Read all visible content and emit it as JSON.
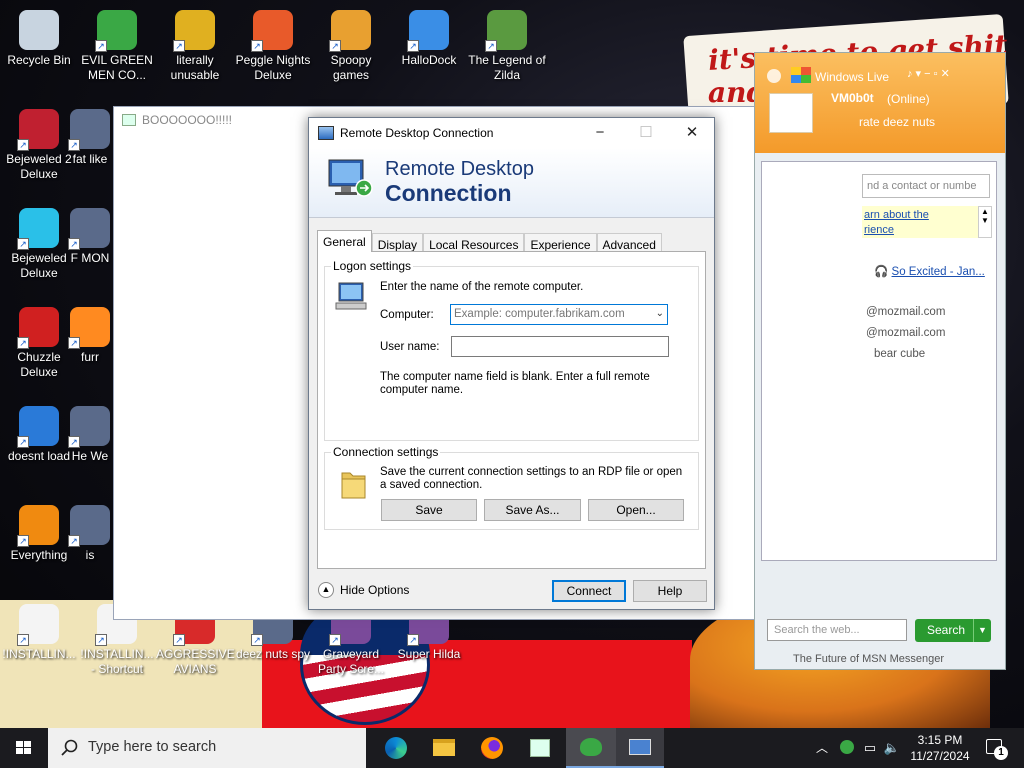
{
  "wallpaper": {
    "note_line1": "it's time to get shit",
    "note_line2": "and"
  },
  "desktop_icons": [
    {
      "label": "Recycle Bin",
      "icon": "recycle-bin-icon"
    },
    {
      "label": "EVIL GREEN MEN CO...",
      "icon": "msn-buddies-icon"
    },
    {
      "label": "literally unusable",
      "icon": "chrome-icon"
    },
    {
      "label": "Peggle Nights Deluxe",
      "icon": "peggle-icon"
    },
    {
      "label": "Spoopy games",
      "icon": "folder-icon"
    },
    {
      "label": "HalloDock",
      "icon": "windows-flag-icon"
    },
    {
      "label": "The Legend of Zilda",
      "icon": "zelda-icon"
    },
    {
      "label": "Bejeweled 2 Deluxe",
      "icon": "bejeweled2-icon"
    },
    {
      "label": "fat like",
      "icon": "app-icon"
    },
    {
      "label": "Bejeweled Deluxe",
      "icon": "diamond-icon"
    },
    {
      "label": "F MON",
      "icon": "app-icon"
    },
    {
      "label": "Chuzzle Deluxe",
      "icon": "chuzzle-icon"
    },
    {
      "label": "furr",
      "icon": "firefox-icon"
    },
    {
      "label": "doesnt load",
      "icon": "thunderbird-icon"
    },
    {
      "label": "He We",
      "icon": "app-icon"
    },
    {
      "label": "Everything",
      "icon": "search-ring-icon"
    },
    {
      "label": "is",
      "icon": "app-icon"
    },
    {
      "label": "!INSTALLIN...",
      "icon": "document-icon"
    },
    {
      "label": "!INSTALLIN... - Shortcut",
      "icon": "document-icon"
    },
    {
      "label": "AGGRESSIVE AVIANS",
      "icon": "angry-bird-icon"
    },
    {
      "label": "deez nuts spy",
      "icon": "app-icon"
    },
    {
      "label": "Graveyard Party Scre...",
      "icon": "game-icon"
    },
    {
      "label": "Super Hilda",
      "icon": "game-icon"
    }
  ],
  "background_window": {
    "title": "BOOOOOOO!!!!!"
  },
  "msn": {
    "app_title": "Windows Live",
    "username": "VM0b0t",
    "status": "(Online)",
    "personal_message": "rate deez nuts",
    "find_placeholder": "nd a contact or numbe",
    "learn_link_1": "arn about the",
    "learn_link_2": "rience",
    "now_playing": "So Excited - Jan...",
    "contacts": [
      "@mozmail.com",
      "@mozmail.com",
      "bear cube"
    ],
    "search_placeholder": "Search the web...",
    "search_button": "Search",
    "footer": "The Future of MSN Messenger"
  },
  "rdp": {
    "title": "Remote Desktop Connection",
    "banner_line1": "Remote Desktop",
    "banner_line2": "Connection",
    "tabs": [
      "General",
      "Display",
      "Local Resources",
      "Experience",
      "Advanced"
    ],
    "logon": {
      "group_label": "Logon settings",
      "instruction": "Enter the name of the remote computer.",
      "computer_label": "Computer:",
      "computer_placeholder": "Example: computer.fabrikam.com",
      "username_label": "User name:",
      "username_value": "",
      "warning": "The computer name field is blank. Enter a full remote computer name."
    },
    "connection": {
      "group_label": "Connection settings",
      "description": "Save the current connection settings to an RDP file or open a saved connection.",
      "save": "Save",
      "save_as": "Save As...",
      "open": "Open..."
    },
    "hide_options": "Hide Options",
    "connect": "Connect",
    "help": "Help"
  },
  "taskbar": {
    "search_placeholder": "Type here to search",
    "apps": [
      "edge-icon",
      "file-explorer-icon",
      "firefox-icon",
      "rdp-manager-icon",
      "msn-messenger-icon",
      "remote-desktop-icon"
    ],
    "time": "3:15 PM",
    "date": "11/27/2024",
    "notification_count": "1"
  },
  "colors": {
    "accent": "#0078d7",
    "banner_text": "#1a3a78",
    "msn_orange": "#f49a2a",
    "taskbar": "#1b1b1f"
  }
}
